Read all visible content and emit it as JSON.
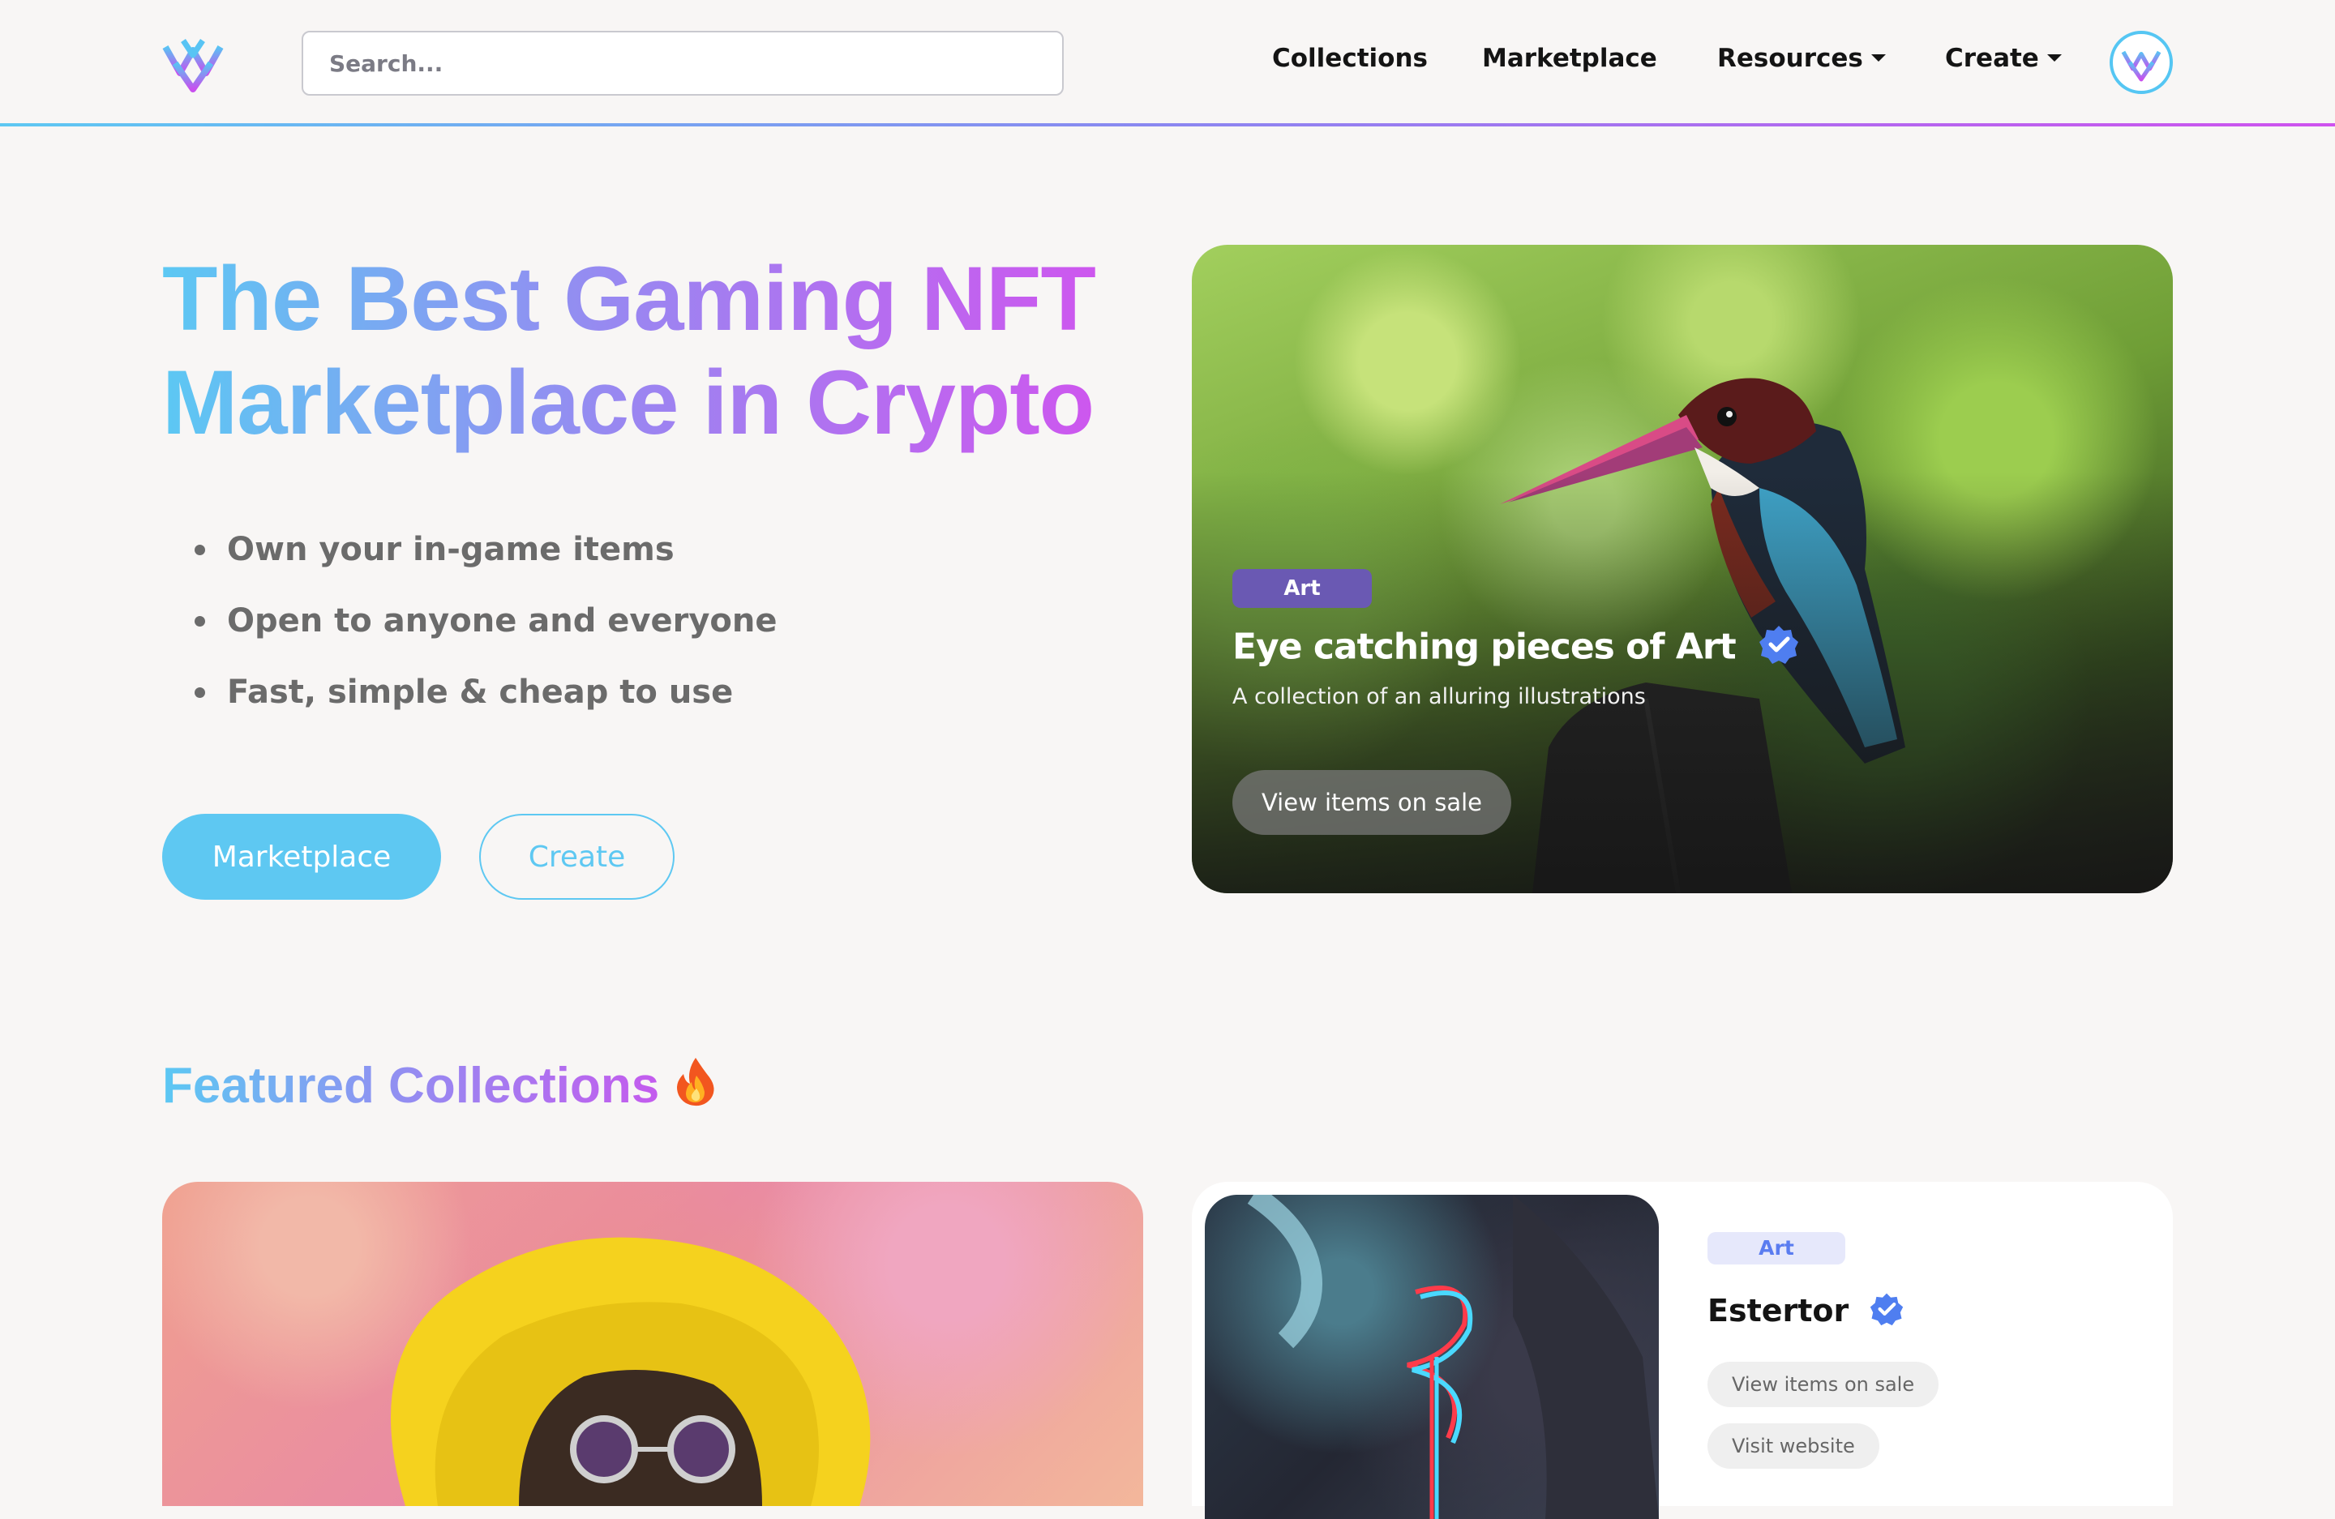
{
  "nav": {
    "search_placeholder": "Search...",
    "links": [
      "Collections",
      "Marketplace"
    ],
    "dropdowns": [
      "Resources",
      "Create"
    ]
  },
  "hero": {
    "title_line1": "The Best Gaming NFT",
    "title_line2": "Marketplace in Crypto",
    "bullets": [
      "Own your in-game items",
      "Open to anyone and everyone",
      "Fast, simple & cheap to use"
    ],
    "primary_button": "Marketplace",
    "secondary_button": "Create"
  },
  "hero_card": {
    "tag": "Art",
    "title": "Eye catching pieces of Art",
    "description": "A collection of an alluring illustrations",
    "button": "View items on sale",
    "verified": true
  },
  "featured": {
    "title": "Featured Collections",
    "icon": "fire-icon",
    "side_card": {
      "tag": "Art",
      "title": "Estertor",
      "verified": true,
      "buttons": [
        "View items on sale",
        "Visit website"
      ]
    }
  },
  "colors": {
    "accent": "#5ec8f2",
    "gradient_start": "#5cc8f3",
    "gradient_mid": "#9a86f1",
    "gradient_end": "#d94cee",
    "verified": "#4f7ef0",
    "tag_bg_dark": "#6a59b3",
    "tag_bg_light": "#e6e8fb"
  }
}
